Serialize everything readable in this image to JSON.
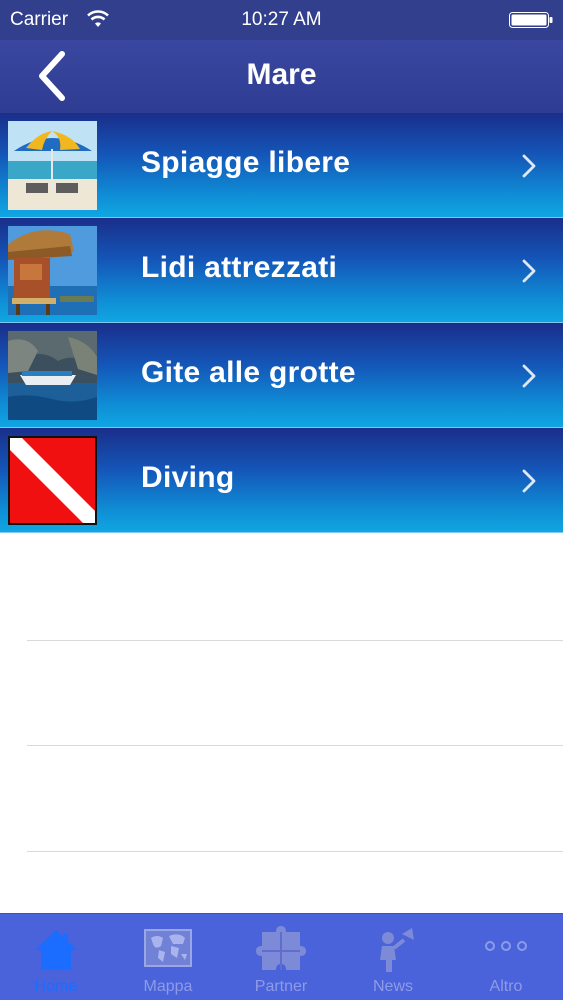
{
  "status_bar": {
    "carrier": "Carrier",
    "time": "10:27 AM"
  },
  "nav": {
    "title": "Mare",
    "back_icon": "chevron-left-icon"
  },
  "items": [
    {
      "label": "Spiagge libere",
      "thumb": "beach-umbrella-photo"
    },
    {
      "label": "Lidi attrezzati",
      "thumb": "beach-hut-photo"
    },
    {
      "label": "Gite alle grotte",
      "thumb": "sea-cave-boat-photo"
    },
    {
      "label": "Diving",
      "thumb": "dive-flag"
    }
  ],
  "tabs": [
    {
      "label": "Home",
      "icon": "home-icon",
      "active": true
    },
    {
      "label": "Mappa",
      "icon": "world-map-icon",
      "active": false
    },
    {
      "label": "Partner",
      "icon": "puzzle-icon",
      "active": false
    },
    {
      "label": "News",
      "icon": "megaphone-person-icon",
      "active": false
    },
    {
      "label": "Altro",
      "icon": "more-dots-icon",
      "active": false
    }
  ],
  "colors": {
    "nav_background": "#2e3c92",
    "row_gradient_top": "#1a2e8a",
    "row_gradient_bottom": "#10a6e2",
    "tabbar_background": "#4a63da",
    "tab_active": "#1a6dff",
    "tab_inactive": "#8d9be8"
  }
}
